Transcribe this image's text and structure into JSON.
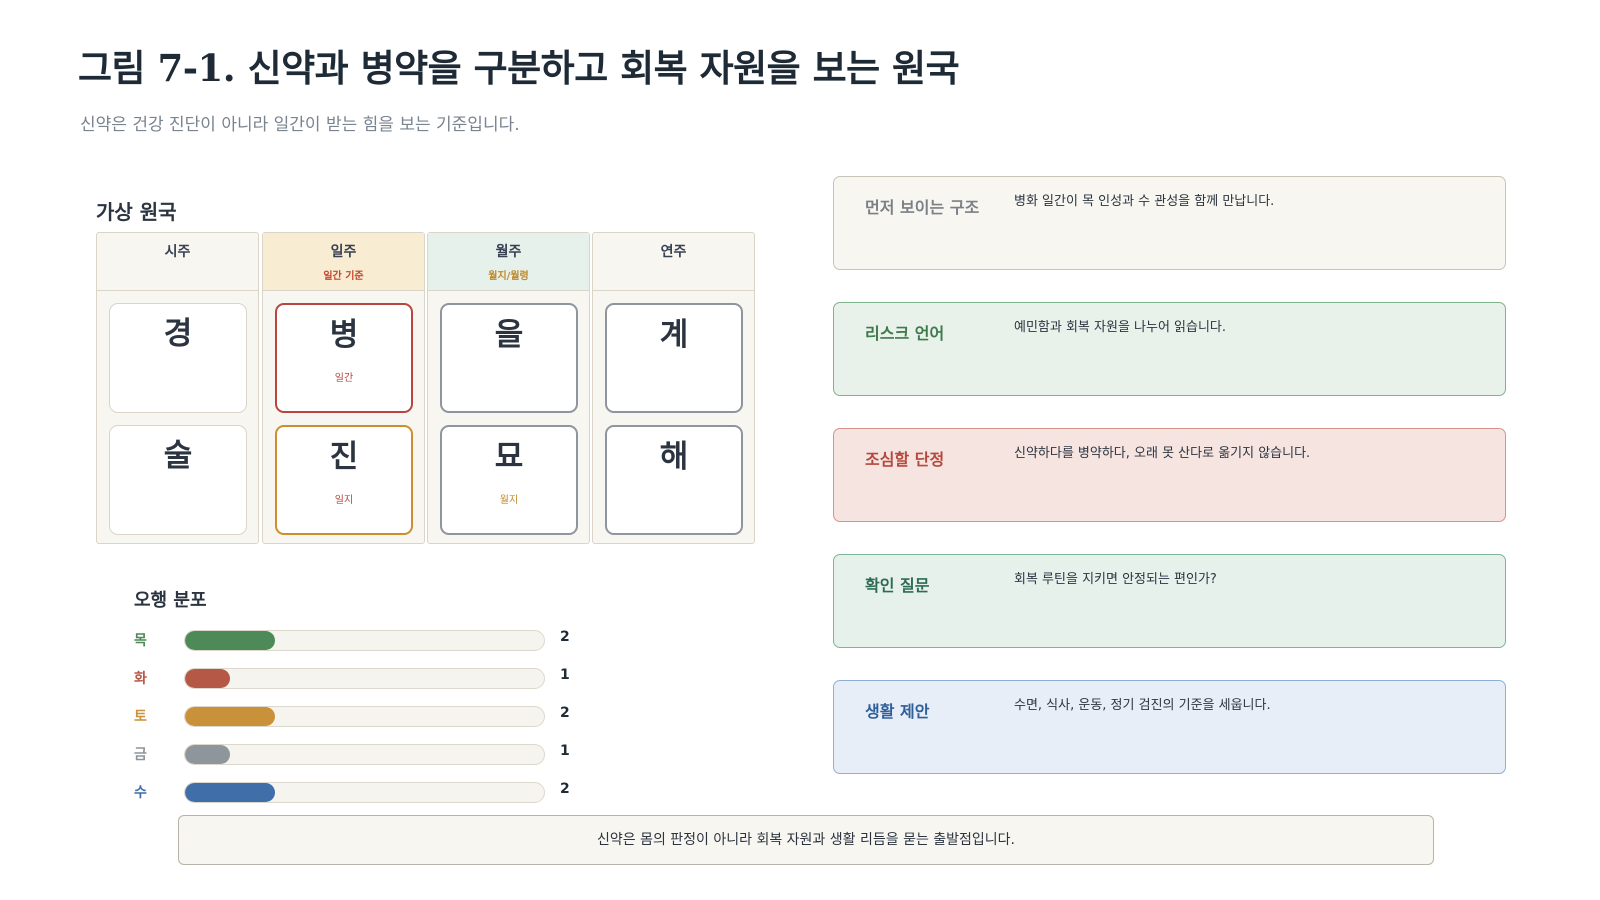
{
  "title": "그림 7-1. 신약과 병약을 구분하고 회복 자원을 보는 원국",
  "subtitle": "신약은 건강 진단이 아니라 일간이 받는 힘을 보는 기준입니다.",
  "chart": {
    "heading": "가상 원국",
    "pillars": [
      {
        "name": "시주",
        "tag": "",
        "stem": "경",
        "stem_note": "",
        "branch": "술",
        "branch_note": ""
      },
      {
        "name": "일주",
        "tag": "일간 기준",
        "stem": "병",
        "stem_note": "일간",
        "branch": "진",
        "branch_note": "일지"
      },
      {
        "name": "월주",
        "tag": "월지/월령",
        "stem": "을",
        "stem_note": "",
        "branch": "묘",
        "branch_note": "월지"
      },
      {
        "name": "연주",
        "tag": "",
        "stem": "계",
        "stem_note": "",
        "branch": "해",
        "branch_note": ""
      }
    ],
    "colors": {
      "day_header_bg": "#f8ecd3",
      "month_header_bg": "#e6f1ec",
      "day_stem_border": "#b8453f",
      "day_branch_border": "#cc8f2e",
      "day_tag": "#c2472f",
      "month_tag": "#c08a2a"
    }
  },
  "ohaeng": {
    "heading": "오행 분포",
    "max": 8,
    "elements": [
      {
        "name": "목",
        "count": 2,
        "color": "#4e8a57"
      },
      {
        "name": "화",
        "count": 1,
        "color": "#b65846"
      },
      {
        "name": "토",
        "count": 2,
        "color": "#c8913a"
      },
      {
        "name": "금",
        "count": 1,
        "color": "#8e959b"
      },
      {
        "name": "수",
        "count": 2,
        "color": "#3f6ea8"
      }
    ]
  },
  "panels": [
    {
      "label": "먼저 보이는 구조",
      "text": "병화 일간이 목 인성과 수 관성을 함께 만납니다.",
      "bg": "#f8f6f0",
      "border": "#c9c4b8",
      "label_color": "#7a8088"
    },
    {
      "label": "리스크 언어",
      "text": "예민함과 회복 자원을 나누어 읽습니다.",
      "bg": "#e8f2ea",
      "border": "#7fb38a",
      "label_color": "#3e7a4a"
    },
    {
      "label": "조심할 단정",
      "text": "신약하다를 병약하다, 오래 못 산다로 옮기지 않습니다.",
      "bg": "#f6e4e0",
      "border": "#d9928a",
      "label_color": "#b5473c"
    },
    {
      "label": "확인 질문",
      "text": "회복 루틴을 지키면 안정되는 편인가?",
      "bg": "#e6f1ec",
      "border": "#7fb39a",
      "label_color": "#2e6b57"
    },
    {
      "label": "생활 제안",
      "text": "수면, 식사, 운동, 정기 검진의 기준을 세웁니다.",
      "bg": "#e7eef8",
      "border": "#8fb0d6",
      "label_color": "#2f5f9a"
    }
  ],
  "footer": "신약은 몸의 판정이 아니라 회복 자원과 생활 리듬을 묻는 출발점입니다."
}
